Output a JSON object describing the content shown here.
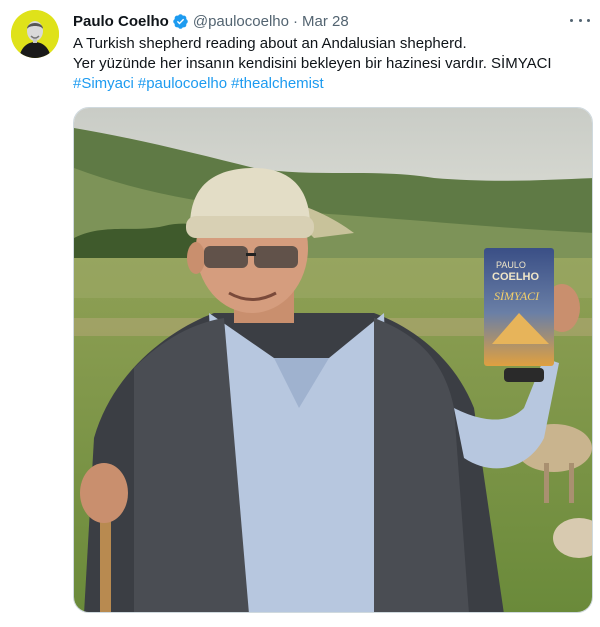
{
  "tweet": {
    "author": {
      "display_name": "Paulo Coelho",
      "handle": "@paulocoelho",
      "verified_icon": "verified-badge-icon",
      "avatar_color": "#dfe21a"
    },
    "separator": "·",
    "timestamp": "Mar 28",
    "more_icon": "more-options-icon",
    "text_lines": [
      "A Turkish shepherd reading about an Andalusian shepherd.",
      "Yer yüzünde her insanın kendisini bekleyen bir hazinesi vardır. SİMYACI"
    ],
    "hashtags": [
      "#Simyaci",
      "#paulocoelho",
      "#thealchemist"
    ],
    "media": {
      "book_title_top": "PAULO",
      "book_title_mid": "COELHO",
      "book_title_main": "SİMYACI"
    }
  },
  "colors": {
    "link": "#1d9bf0",
    "secondary_text": "#536471",
    "primary_text": "#0f1419",
    "border": "#cfd9de"
  }
}
